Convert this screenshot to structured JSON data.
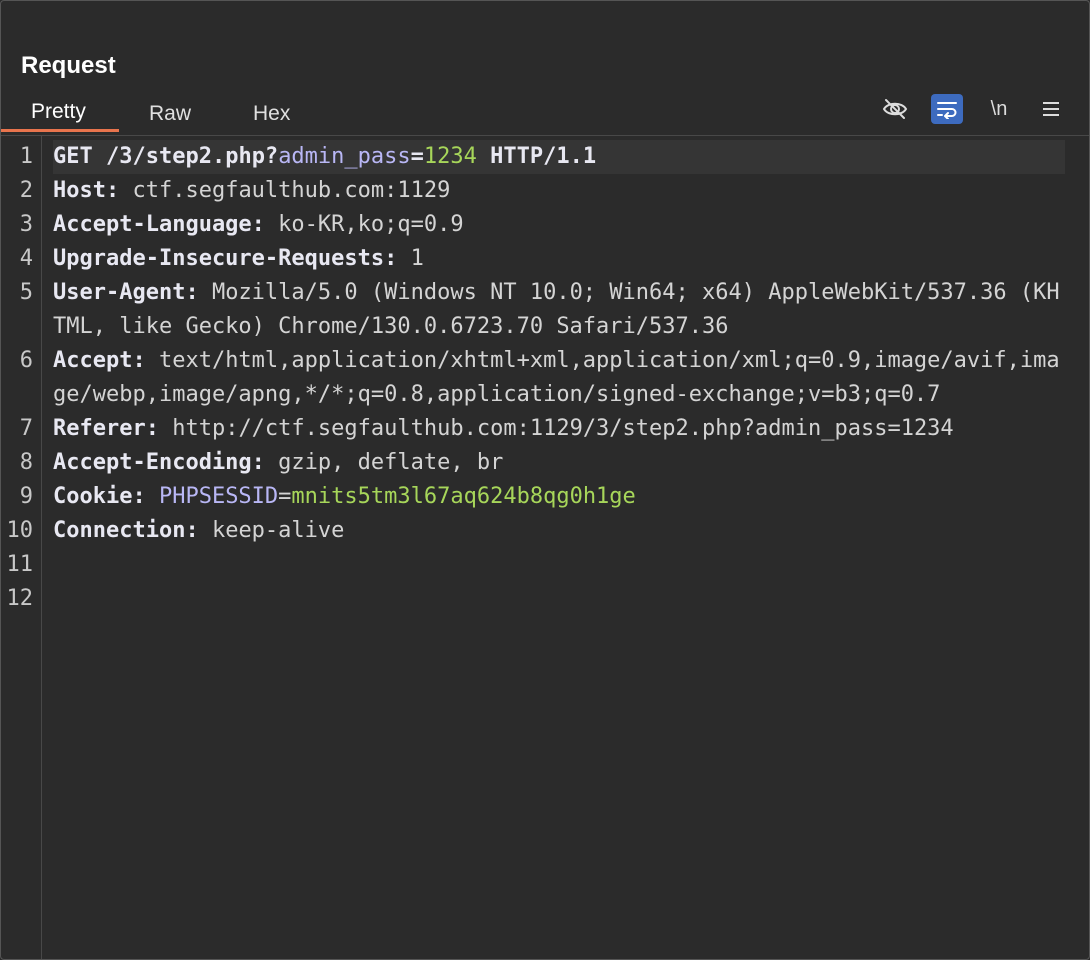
{
  "panel": {
    "title": "Request"
  },
  "tabs": [
    {
      "label": "Pretty",
      "active": true
    },
    {
      "label": "Raw",
      "active": false
    },
    {
      "label": "Hex",
      "active": false
    }
  ],
  "toolbar": {
    "hide_icon": "eye-slash-icon",
    "wrap_icon": "word-wrap-icon",
    "wrap_active": true,
    "newline_label": "\\n",
    "menu_icon": "hamburger-menu-icon"
  },
  "colors": {
    "background": "#2b2b2b",
    "active_tab_underline": "#e8744d",
    "active_toolbar_button": "#3d6bbf",
    "param_name": "#b9b7f5",
    "param_value": "#a7d65a"
  },
  "lines": [
    {
      "num": "1",
      "method": "GET",
      "path": " /3/step2.php?",
      "param_name": "admin_pass",
      "eq": "=",
      "param_value": "1234",
      "protocol": " HTTP/1.1"
    },
    {
      "num": "2",
      "key": "Host:",
      "value": " ctf.segfaulthub.com:1129"
    },
    {
      "num": "3",
      "key": "Accept-Language:",
      "value": " ko-KR,ko;q=0.9"
    },
    {
      "num": "4",
      "key": "Upgrade-Insecure-Requests:",
      "value": " 1"
    },
    {
      "num": "5",
      "key": "User-Agent:",
      "value": " Mozilla/5.0 (Windows NT 10.0; Win64; x64) AppleWebKit/537.36 (KHTML, like Gecko) Chrome/130.0.6723.70 Safari/537.36"
    },
    {
      "num": "6",
      "key": "Accept:",
      "value": " text/html,application/xhtml+xml,application/xml;q=0.9,image/avif,image/webp,image/apng,*/*;q=0.8,application/signed-exchange;v=b3;q=0.7"
    },
    {
      "num": "7",
      "key": "Referer:",
      "value": " http://ctf.segfaulthub.com:1129/3/step2.php?admin_pass=1234"
    },
    {
      "num": "8",
      "key": "Accept-Encoding:",
      "value": " gzip, deflate, br"
    },
    {
      "num": "9",
      "key": "Cookie:",
      "cookie_name": " PHPSESSID",
      "eq": "=",
      "cookie_value": "mnits5tm3l67aq624b8qg0h1ge"
    },
    {
      "num": "10",
      "key": "Connection:",
      "value": " keep-alive"
    },
    {
      "num": "11"
    },
    {
      "num": "12"
    }
  ]
}
